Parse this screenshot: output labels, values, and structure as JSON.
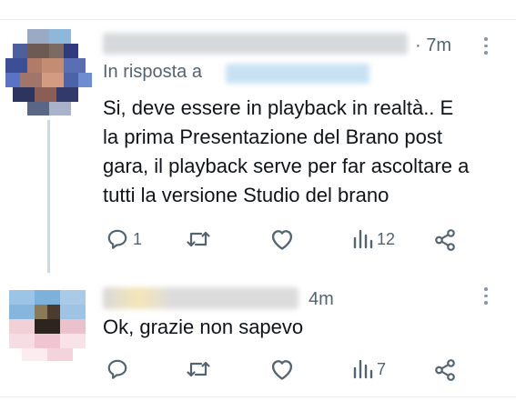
{
  "tweet1": {
    "time": "· 7m",
    "reply_prefix": "In risposta a",
    "text_lines": [
      "Si, deve essere in playback in realtà.. E",
      "la prima Presentazione del Brano post",
      "gara, il playback serve per far ascoltare a",
      "tutti la versione Studio del brano"
    ],
    "actions": {
      "replies": "1",
      "retweets": "",
      "likes": "",
      "views": "12"
    }
  },
  "tweet2": {
    "time": "4m",
    "text": "Ok, grazie non sapevo",
    "actions": {
      "replies": "",
      "retweets": "",
      "likes": "",
      "views": "7"
    }
  },
  "icons": [
    "reply-icon",
    "retweet-icon",
    "like-icon",
    "views-icon",
    "share-icon",
    "more-icon"
  ],
  "colors": {
    "text": "#0f1419",
    "secondary": "#536471",
    "divider": "#e6ecf0",
    "thread_line": "#cfd9de"
  }
}
